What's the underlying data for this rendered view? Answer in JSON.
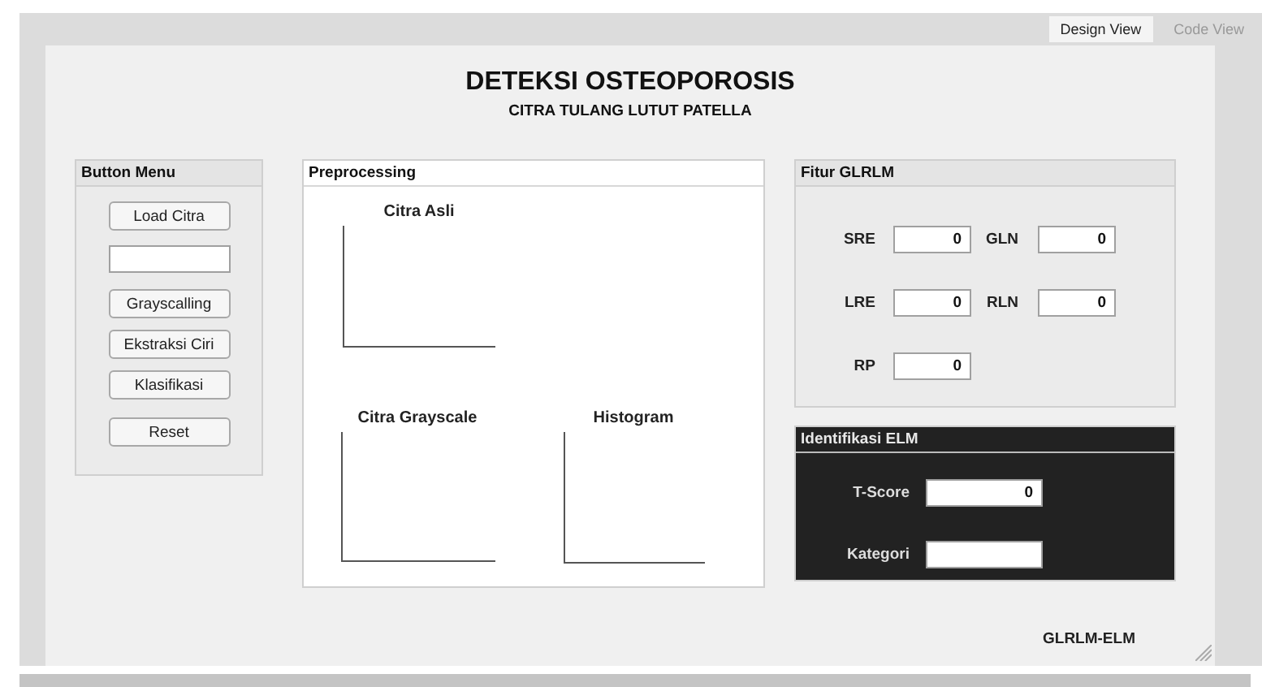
{
  "view_tabs": [
    {
      "label": "Design View",
      "selected": true
    },
    {
      "label": "Code View",
      "selected": false
    }
  ],
  "title": "DETEKSI OSTEOPOROSIS",
  "subtitle": "CITRA TULANG LUTUT PATELLA",
  "button_menu": {
    "title": "Button Menu",
    "items": [
      {
        "kind": "button",
        "label": "Load Citra"
      },
      {
        "kind": "field"
      },
      {
        "kind": "button",
        "label": "Grayscalling"
      },
      {
        "kind": "button",
        "label": "Ekstraksi Ciri"
      },
      {
        "kind": "button",
        "label": "Klasifikasi"
      },
      {
        "kind": "button",
        "label": "Reset"
      }
    ]
  },
  "preprocessing": {
    "title": "Preprocessing",
    "axes": [
      {
        "title": "Citra Asli"
      },
      {
        "title": "Citra Grayscale"
      },
      {
        "title": "Histogram"
      }
    ]
  },
  "fitur_glrlm": {
    "title": "Fitur GLRLM",
    "fields": [
      {
        "label": "SRE",
        "value": "0"
      },
      {
        "label": "GLN",
        "value": "0"
      },
      {
        "label": "LRE",
        "value": "0"
      },
      {
        "label": "RLN",
        "value": "0"
      },
      {
        "label": "RP",
        "value": "0"
      }
    ]
  },
  "identifikasi_elm": {
    "title": "Identifikasi ELM",
    "fields": [
      {
        "label": "T-Score",
        "value": "0"
      },
      {
        "label": "Kategori"
      }
    ]
  },
  "footer_label": "GLRLM-ELM"
}
